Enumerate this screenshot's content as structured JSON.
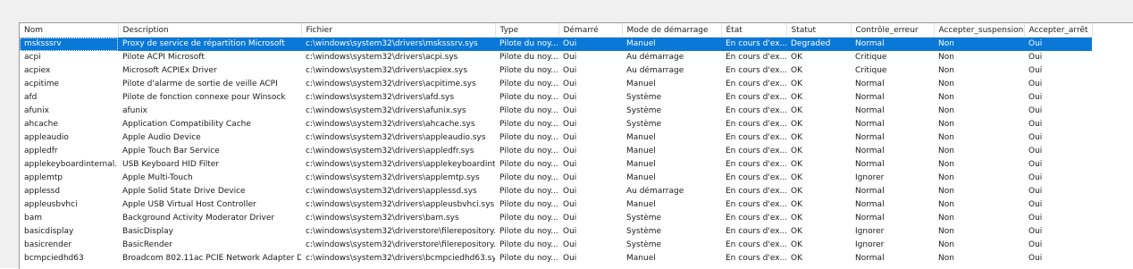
{
  "columns": [
    "Nom",
    "Description",
    "Fichier",
    "Type",
    "Démarré",
    "Mode de démarrage",
    "État",
    "Statut",
    "Contrôle_erreur",
    "Accepter_suspension",
    "Accepter_arrêt"
  ],
  "rows": [
    [
      "msksssrv",
      "Proxy de service de répartition Microsoft",
      "c:\\windows\\system32\\drivers\\msksssrv.sys",
      "Pilote du noy...",
      "Oui",
      "Manuel",
      "En cours d'ex...",
      "Degraded",
      "Normal",
      "Non",
      "Oui"
    ],
    [
      "acpi",
      "Pilote ACPI Microsoft",
      "c:\\windows\\system32\\drivers\\acpi.sys",
      "Pilote du noy...",
      "Oui",
      "Au démarrage",
      "En cours d'ex...",
      "OK",
      "Critique",
      "Non",
      "Oui"
    ],
    [
      "acpiex",
      "Microsoft ACPIEx Driver",
      "c:\\windows\\system32\\drivers\\acpiex.sys",
      "Pilote du noy...",
      "Oui",
      "Au démarrage",
      "En cours d'ex...",
      "OK",
      "Critique",
      "Non",
      "Oui"
    ],
    [
      "acpitime",
      "Pilote d'alarme de sortie de veille ACPI",
      "c:\\windows\\system32\\drivers\\acpitime.sys",
      "Pilote du noy...",
      "Oui",
      "Manuel",
      "En cours d'ex...",
      "OK",
      "Normal",
      "Non",
      "Oui"
    ],
    [
      "afd",
      "Pilote de fonction connexe pour Winsock",
      "c:\\windows\\system32\\drivers\\afd.sys",
      "Pilote du noy...",
      "Oui",
      "Système",
      "En cours d'ex...",
      "OK",
      "Normal",
      "Non",
      "Oui"
    ],
    [
      "afunix",
      "afunix",
      "c:\\windows\\system32\\drivers\\afunix.sys",
      "Pilote du noy...",
      "Oui",
      "Système",
      "En cours d'ex...",
      "OK",
      "Normal",
      "Non",
      "Oui"
    ],
    [
      "ahcache",
      "Application Compatibility Cache",
      "c:\\windows\\system32\\drivers\\ahcache.sys",
      "Pilote du noy...",
      "Oui",
      "Système",
      "En cours d'ex...",
      "OK",
      "Normal",
      "Non",
      "Oui"
    ],
    [
      "appleaudio",
      "Apple Audio Device",
      "c:\\windows\\system32\\drivers\\appleaudio.sys",
      "Pilote du noy...",
      "Oui",
      "Manuel",
      "En cours d'ex...",
      "OK",
      "Normal",
      "Non",
      "Oui"
    ],
    [
      "appledfr",
      "Apple Touch Bar Service",
      "c:\\windows\\system32\\drivers\\appledfr.sys",
      "Pilote du noy...",
      "Oui",
      "Manuel",
      "En cours d'ex...",
      "OK",
      "Normal",
      "Non",
      "Oui"
    ],
    [
      "applekeyboardinternal...",
      "USB Keyboard HID Filter",
      "c:\\windows\\system32\\drivers\\applekeyboardint...",
      "Pilote du noy...",
      "Oui",
      "Manuel",
      "En cours d'ex...",
      "OK",
      "Normal",
      "Non",
      "Oui"
    ],
    [
      "applemtp",
      "Apple Multi-Touch",
      "c:\\windows\\system32\\drivers\\applemtp.sys",
      "Pilote du noy...",
      "Oui",
      "Manuel",
      "En cours d'ex...",
      "OK",
      "Ignorer",
      "Non",
      "Oui"
    ],
    [
      "applessd",
      "Apple Solid State Drive Device",
      "c:\\windows\\system32\\drivers\\applessd.sys",
      "Pilote du noy...",
      "Oui",
      "Au démarrage",
      "En cours d'ex...",
      "OK",
      "Normal",
      "Non",
      "Oui"
    ],
    [
      "appleusbvhci",
      "Apple USB Virtual Host Controller",
      "c:\\windows\\system32\\drivers\\appleusbvhci.sys",
      "Pilote du noy...",
      "Oui",
      "Manuel",
      "En cours d'ex...",
      "OK",
      "Normal",
      "Non",
      "Oui"
    ],
    [
      "bam",
      "Background Activity Moderator Driver",
      "c:\\windows\\system32\\drivers\\bam.sys",
      "Pilote du noy...",
      "Oui",
      "Système",
      "En cours d'ex...",
      "OK",
      "Normal",
      "Non",
      "Oui"
    ],
    [
      "basicdisplay",
      "BasicDisplay",
      "c:\\windows\\system32\\driverstore\\filerepository...",
      "Pilote du noy...",
      "Oui",
      "Système",
      "En cours d'ex...",
      "OK",
      "Ignorer",
      "Non",
      "Oui"
    ],
    [
      "basicrender",
      "BasicRender",
      "c:\\windows\\system32\\driverstore\\filerepository...",
      "Pilote du noy...",
      "Oui",
      "Système",
      "En cours d'ex...",
      "OK",
      "Ignorer",
      "Non",
      "Oui"
    ],
    [
      "bcmpciedhd63",
      "Broadcom 802.11ac PCIE Network Adapter D...",
      "c:\\windows\\system32\\drivers\\bcmpciedhd63.sys",
      "Pilote du noy...",
      "Oui",
      "Manuel",
      "En cours d'ex...",
      "OK",
      "Normal",
      "Non",
      "Oui"
    ]
  ],
  "selected_row": 0,
  "colors": {
    "selection": "#0a78d7",
    "chrome": "#f0f0f0",
    "border": "#9a9a9a"
  }
}
